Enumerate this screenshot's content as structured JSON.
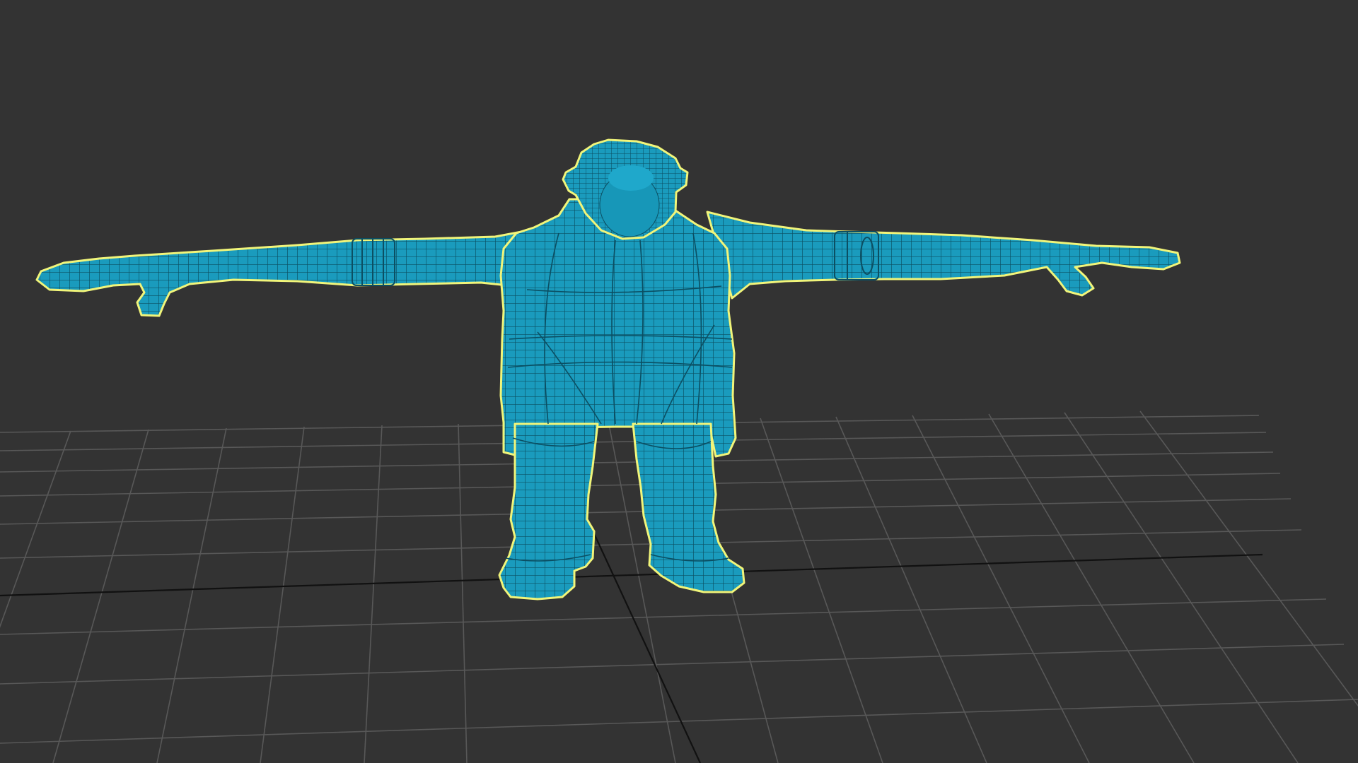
{
  "viewport": {
    "view_mode": "wireframe",
    "background_color": "#333333",
    "grid_color": "#585858",
    "axis_color": "#111111"
  },
  "model": {
    "pose": "T-pose",
    "wire_color": "#1a9bbd",
    "fill_color": "#1a9bbd",
    "selection_outline_color": "#f1f57a",
    "selected": true
  }
}
